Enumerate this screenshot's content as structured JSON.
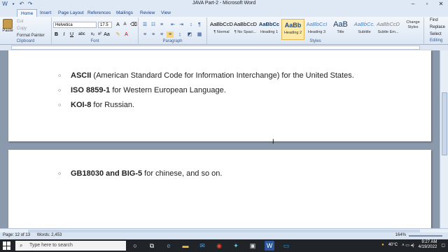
{
  "window": {
    "title": "JAVA Part-2 - Microsoft Word"
  },
  "tabs": [
    "Home",
    "Insert",
    "Page Layout",
    "References",
    "Mailings",
    "Review",
    "View"
  ],
  "clipboard": {
    "paste": "Paste",
    "cut": "Cut",
    "copy": "Copy",
    "format_painter": "Format Painter",
    "label": "Clipboard"
  },
  "font": {
    "name": "Helvetica",
    "size": "17.5",
    "label": "Font"
  },
  "paragraph": {
    "label": "Paragraph"
  },
  "styles": {
    "label": "Styles",
    "items": [
      {
        "sample": "AaBbCcDc",
        "name": "¶ Normal"
      },
      {
        "sample": "AaBbCcDc",
        "name": "¶ No Spaci..."
      },
      {
        "sample": "AaBbCc",
        "name": "Heading 1"
      },
      {
        "sample": "AaBb",
        "name": "Heading 2"
      },
      {
        "sample": "AaBbCcI",
        "name": "Heading 3"
      },
      {
        "sample": "AaB",
        "name": "Title"
      },
      {
        "sample": "AaBbCc.",
        "name": "Subtitle"
      },
      {
        "sample": "AaBbCcDc",
        "name": "Subtle Em..."
      }
    ],
    "change_styles": "Change Styles"
  },
  "editing": {
    "find": "Find",
    "replace": "Replace",
    "select": "Select",
    "label": "Editing"
  },
  "document": {
    "page1": [
      {
        "bold": "ASCII",
        "rest": " (American Standard Code for Information Interchange) for the United States."
      },
      {
        "bold": "ISO 8859-1",
        "rest": " for Western European Language."
      },
      {
        "bold": "KOI-8",
        "rest": " for Russian."
      }
    ],
    "page2": [
      {
        "bold": "GB18030 and BIG-5",
        "rest": " for chinese, and so on."
      }
    ]
  },
  "statusbar": {
    "page": "Page: 12 of 13",
    "words": "Words: 2,453",
    "zoom": "164%"
  },
  "taskbar": {
    "search_placeholder": "Type here to search",
    "temperature": "40°C",
    "time": "9:27 AM",
    "date": "4/19/2022"
  }
}
